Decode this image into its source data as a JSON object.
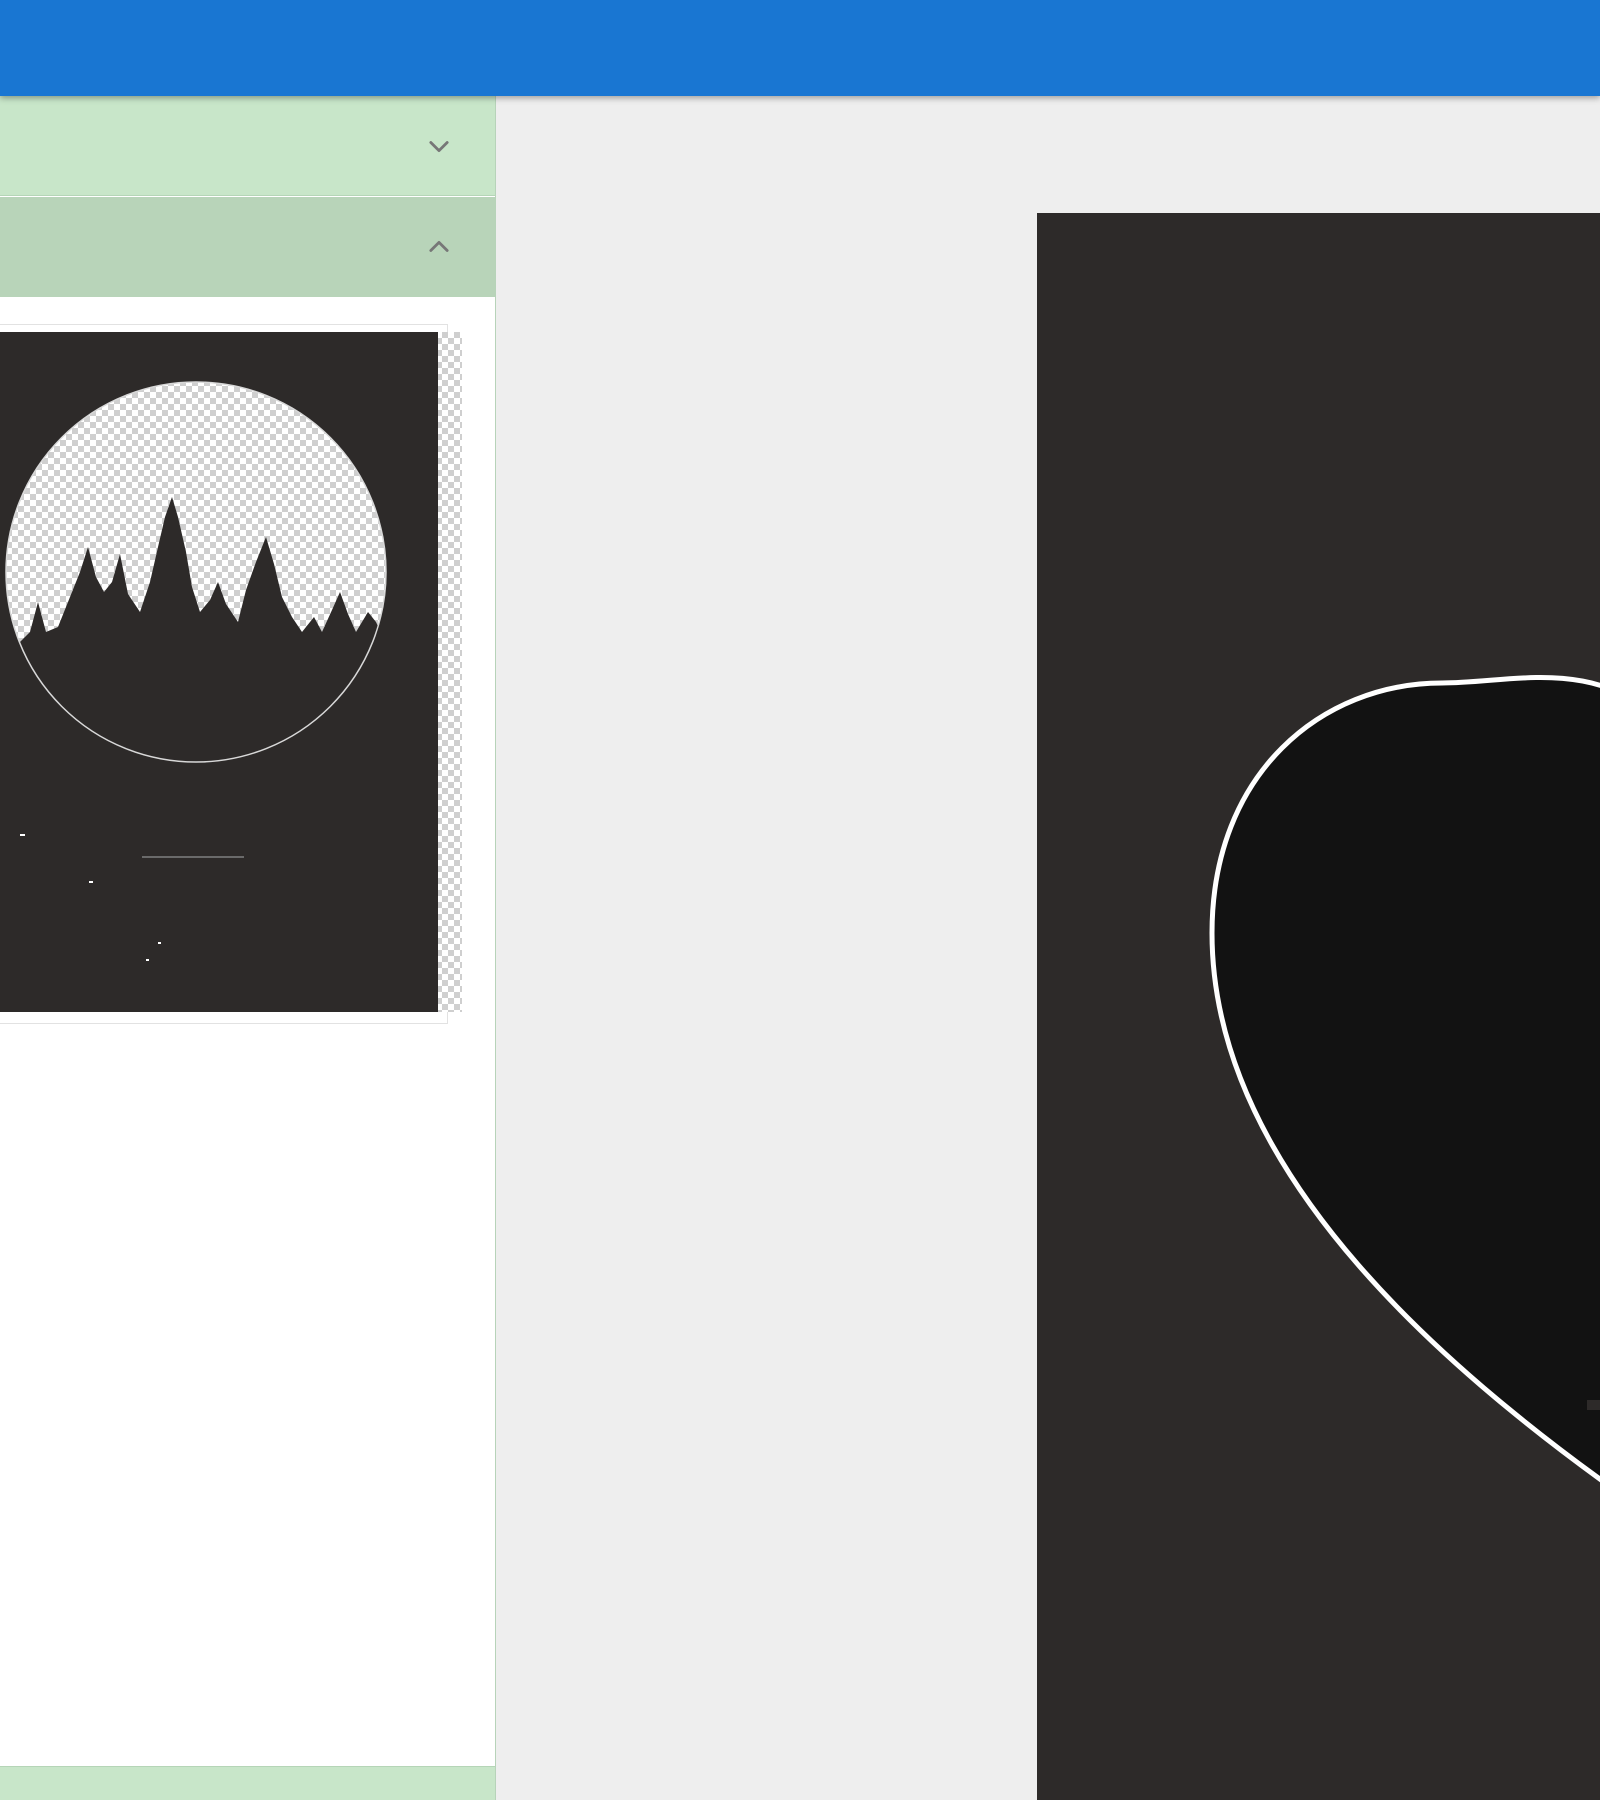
{
  "app": {
    "accent_color": "#1976d2",
    "panel_color": "#c8e6c9",
    "panel_active_color": "#b8d4b9"
  },
  "sidebar": {
    "sections": [
      {
        "icon": "chevron-down-icon",
        "expanded": false
      },
      {
        "icon": "chevron-up-icon",
        "expanded": true
      },
      {
        "icon": "",
        "expanded": false
      }
    ],
    "thumbnail": {
      "design": "forest-circle-poster",
      "background_color": "#2d2a29"
    }
  },
  "canvas": {
    "page_color": "#2d2a29",
    "shape": "heart",
    "shape_fill": "#121212",
    "shape_stroke": "#ffffff"
  }
}
